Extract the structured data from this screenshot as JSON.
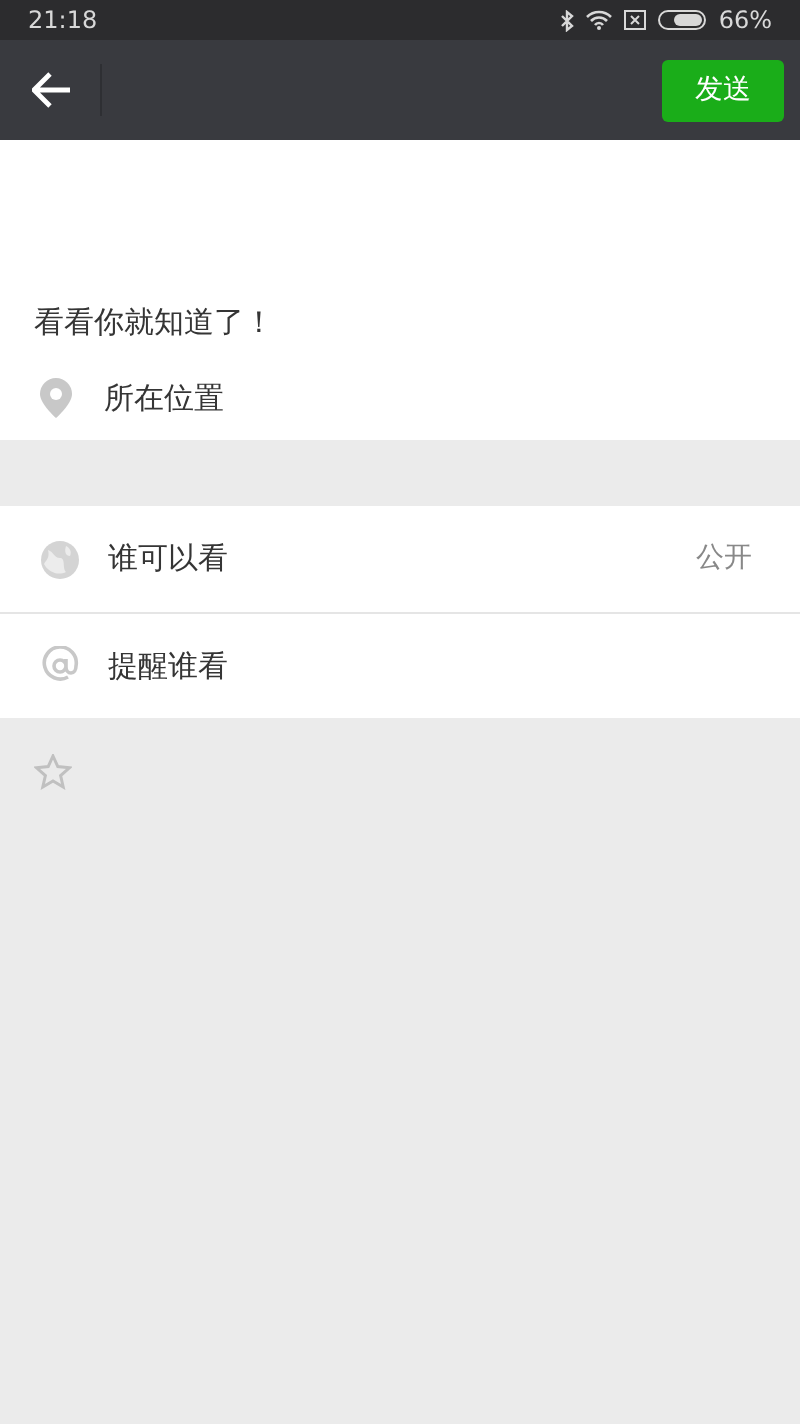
{
  "status_bar": {
    "time": "21:18",
    "battery": "66%"
  },
  "top_bar": {
    "send_button": "发送"
  },
  "post": {
    "text": "看看你就知道了！",
    "location": "所在位置"
  },
  "options": [
    {
      "kind": "visibility",
      "label": "谁可以看",
      "value": "公开"
    },
    {
      "kind": "mention",
      "label": "提醒谁看"
    }
  ]
}
